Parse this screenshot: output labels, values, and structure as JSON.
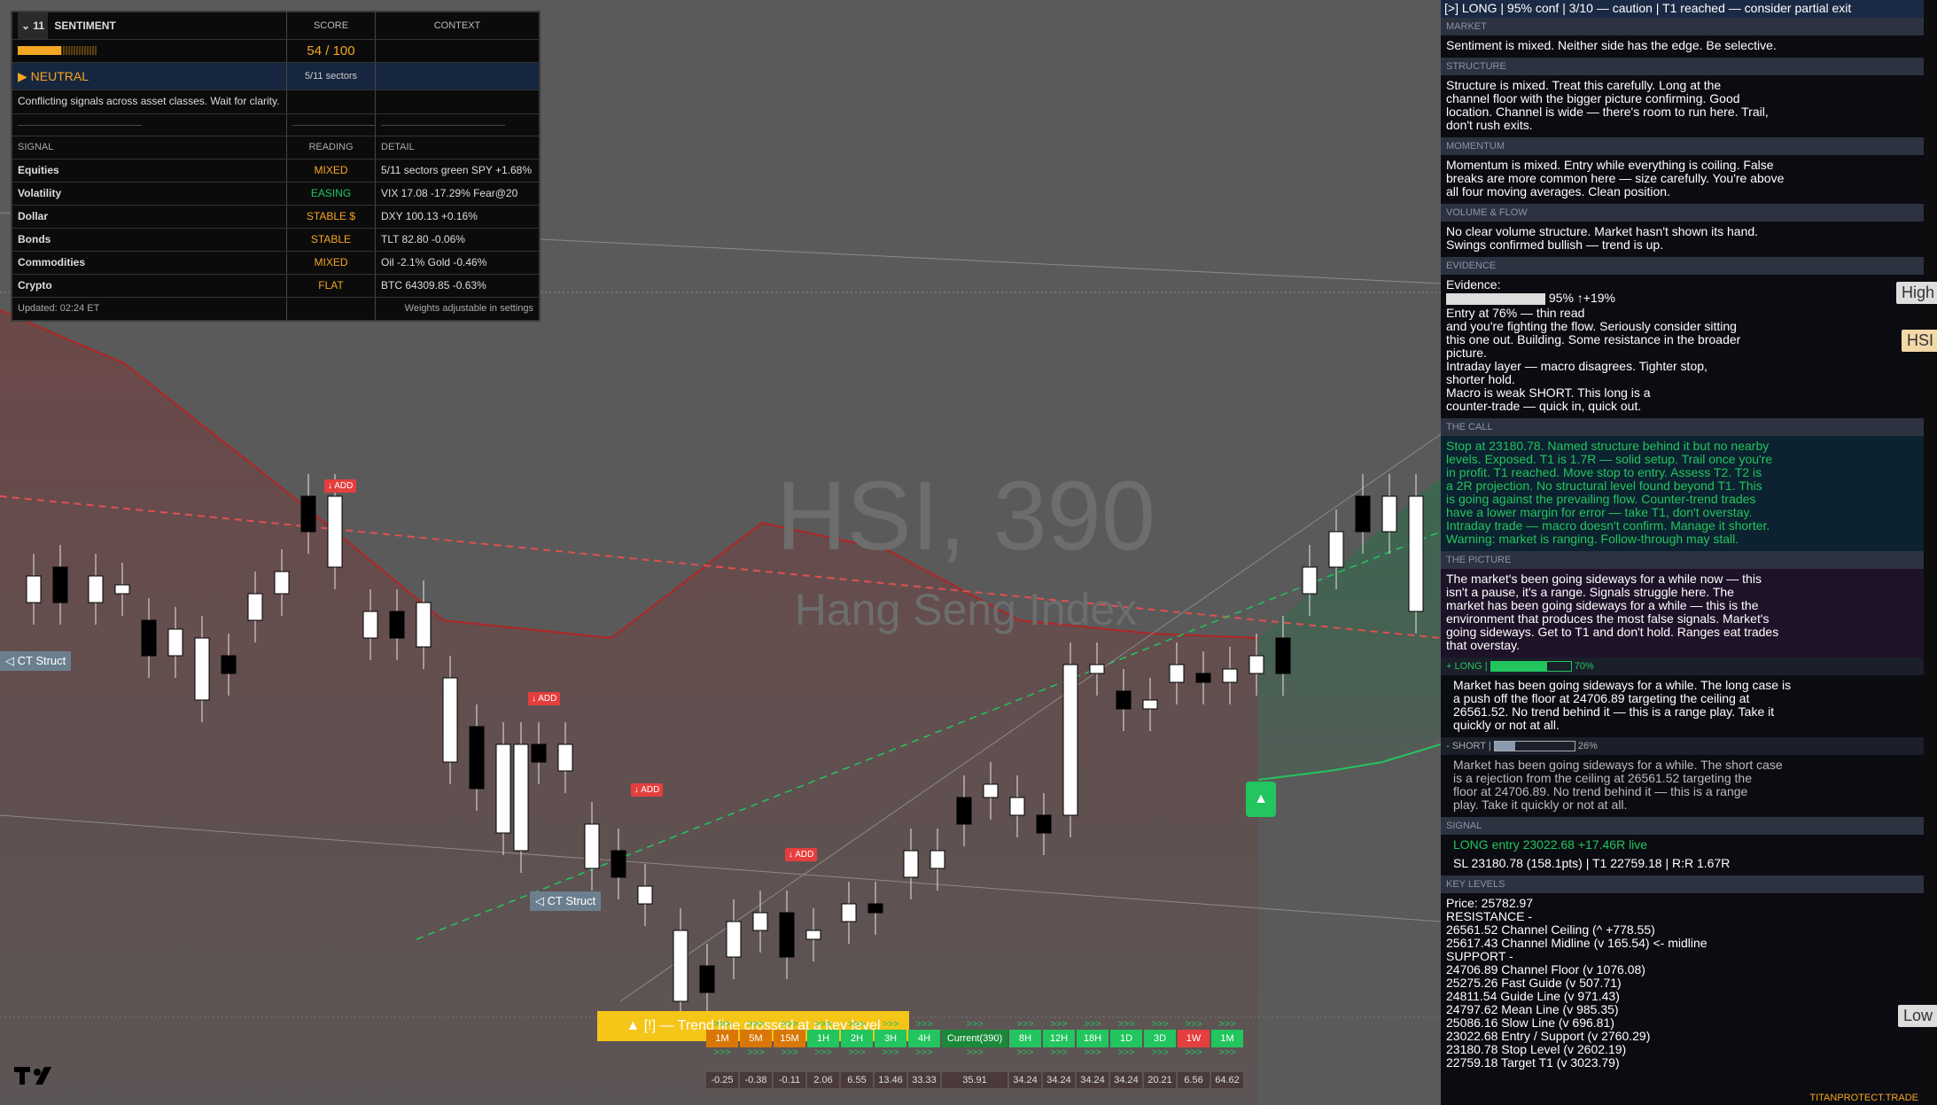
{
  "chart": {
    "symbol": "HSI, 390",
    "name": "Hang Seng Index",
    "ct_label": "◁ CT Struct",
    "add_label": "↓ ADD",
    "banner": "▲ [!] — Trend line crossed at a key level",
    "scale_high": "High",
    "scale_hsi": "HSI",
    "scale_low": "Low",
    "tf_labels": [
      "1M",
      "5M",
      "15M",
      "1H",
      "2H",
      "3H",
      "4H",
      "Current(390)",
      "8H",
      "12H",
      "18H",
      "1D",
      "3D",
      "1W",
      "1M"
    ],
    "tf_values": [
      "-0.25",
      "-0.38",
      "-0.11",
      "2.06",
      "6.55",
      "13.46",
      "33.33",
      "35.91",
      "34.24",
      "34.24",
      "34.24",
      "34.24",
      "20.21",
      "6.56",
      "64.62"
    ]
  },
  "sentiment": {
    "title": "SENTIMENT",
    "col_score": "SCORE",
    "col_context": "CONTEXT",
    "score": "54 / 100",
    "state": "▶ NEUTRAL",
    "sectors": "5/11 sectors",
    "note": "Conflicting signals across asset classes. Wait for clarity.",
    "divider": "——————————————",
    "col_signal": "SIGNAL",
    "col_reading": "READING",
    "col_detail": "DETAIL",
    "rows": [
      {
        "signal": "Equities",
        "reading": "MIXED",
        "detail": "5/11 sectors green  SPY +1.68%"
      },
      {
        "signal": "Volatility",
        "reading": "EASING",
        "detail": "VIX 17.08  -17.29%  Fear@20"
      },
      {
        "signal": "Dollar",
        "reading": "STABLE $",
        "detail": "DXY 100.13  +0.16%"
      },
      {
        "signal": "Bonds",
        "reading": "STABLE",
        "detail": "TLT 82.80  -0.06%"
      },
      {
        "signal": "Commodities",
        "reading": "MIXED",
        "detail": "Oil -2.1%  Gold -0.46%"
      },
      {
        "signal": "Crypto",
        "reading": "FLAT",
        "detail": "BTC 64309.85  -0.63%"
      }
    ],
    "updated": "Updated: 02:24 ET",
    "weights": "Weights adjustable in settings",
    "score_level": 0.54,
    "collapse_label": "11"
  },
  "panel": {
    "top": "[>]  LONG  |  95% conf  |  3/10 — caution  |  T1 reached — consider partial exit",
    "market_h": "MARKET",
    "market": "Sentiment is mixed. Neither side has the edge. Be selective.",
    "structure_h": "STRUCTURE",
    "structure": "Structure is mixed. Treat this carefully. Long at the\nchannel floor with the bigger picture confirming. Good\nlocation. Channel is wide — there's room to run here. Trail,\ndon't rush exits.",
    "momentum_h": "MOMENTUM",
    "momentum": "Momentum is mixed. Entry while everything is coiling. False\nbreaks are more common here — size carefully. You're above\nall four moving averages. Clean position.",
    "volume_h": "VOLUME & FLOW",
    "volume": "No clear volume structure. Market hasn't shown its hand.\nSwings confirmed bullish — trend is up.",
    "evidence_h": "EVIDENCE",
    "evidence_label": "Evidence:",
    "evidence_conf": "95% ↑+19%",
    "evidence": "Entry at 76% — thin read\nand you're fighting the flow. Seriously consider sitting\nthis one out.  Building. Some resistance in the broader\npicture.\nIntraday layer — macro disagrees. Tighter stop,\nshorter hold.\nMacro is weak SHORT. This long is a\ncounter-trade — quick in, quick out.",
    "call_h": "THE CALL",
    "call": "Stop at 23180.78. Named structure behind it but no nearby\nlevels. Exposed. T1 is 1.7R — solid setup. Trail once you're\nin profit. T1 reached. Move stop to entry. Assess T2. T2 is\na 2R projection. No structural level found beyond T1. This\nis going against the prevailing flow. Counter-trend trades\nhave a lower margin for error — take T1, don't overstay.\nIntraday trade — macro doesn't confirm. Manage it shorter.\nWarning: market is ranging. Follow-through may stall.",
    "picture_h": "THE PICTURE",
    "picture": "The market's been going sideways for a while now — this\nisn't a pause, it's a range. Signals struggle here. The\nmarket has been going sideways for a while — this is the\nenvironment that produces the most false signals. Market's\ngoing sideways. Get to T1 and don't hold. Ranges eat trades\nthat overstay.",
    "long_h": "+ LONG  |",
    "long_pct": "70%",
    "long_level": 0.7,
    "long": "Market has been going sideways for a while. The long case is\na push off the floor at 24706.89 targeting the ceiling at\n26561.52. No trend behind it — this is a range play. Take it\nquickly or not at all.",
    "short_h": "- SHORT  |",
    "short_pct": "26%",
    "short_level": 0.26,
    "short": "Market has been going sideways for a while. The short case\nis a rejection from the ceiling at 26561.52 targeting the\nfloor at 24706.89. No trend behind it — this is a range\nplay. Take it quickly or not at all.",
    "signal_h": "SIGNAL",
    "signal1": "LONG  entry 23022.68  +17.46R live",
    "signal2": "SL 23180.78  (158.1pts)   |   T1 22759.18   |   R:R 1.67R",
    "levels_h": "KEY LEVELS",
    "levels": "Price: 25782.97\n  RESISTANCE  -\n26561.52  Channel Ceiling  (^ +778.55)\n25617.43  Channel Midline  (v 165.54)  <- midline\n  SUPPORT  -\n24706.89  Channel Floor  (v 1076.08)\n25275.26  Fast Guide  (v 507.71)\n24811.54  Guide Line  (v 971.43)\n24797.62  Mean Line  (v 985.35)\n25086.16  Slow Line  (v 696.81)\n23022.68  Entry / Support  (v 2760.29)\n23180.78  Stop Level  (v 2602.19)\n22759.18  Target T1  (v 3023.79)",
    "footer": "TITANPROTECT.TRADE"
  }
}
